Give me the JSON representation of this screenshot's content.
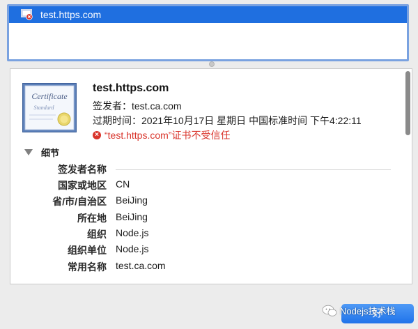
{
  "certificate_list": {
    "selected_item": "test.https.com",
    "icon": "untrusted-certificate-icon"
  },
  "certificate": {
    "image_text_1": "Certificate",
    "image_text_2": "Standard",
    "name": "test.https.com",
    "issuer_line": "签发者：test.ca.com",
    "expires_line": "过期时间：2021年10月17日 星期日 中国标准时间 下午4:22:11",
    "warning_text": "“test.https.com”证书不受信任",
    "warning_icon": "error-circle-icon"
  },
  "details": {
    "toggle_label": "细节",
    "fields": [
      {
        "label": "签发者名称",
        "value": ""
      },
      {
        "label": "国家或地区",
        "value": "CN"
      },
      {
        "label": "省/市/自治区",
        "value": "BeiJing"
      },
      {
        "label": "所在地",
        "value": "BeiJing"
      },
      {
        "label": "组织",
        "value": "Node.js"
      },
      {
        "label": "组织单位",
        "value": "Node.js"
      },
      {
        "label": "常用名称",
        "value": "test.ca.com"
      }
    ]
  },
  "buttons": {
    "ok_label": "好"
  },
  "watermark": {
    "text": "Nodejs技术栈"
  },
  "colors": {
    "accent": "#1f6fe0",
    "warning": "#d9342b"
  }
}
